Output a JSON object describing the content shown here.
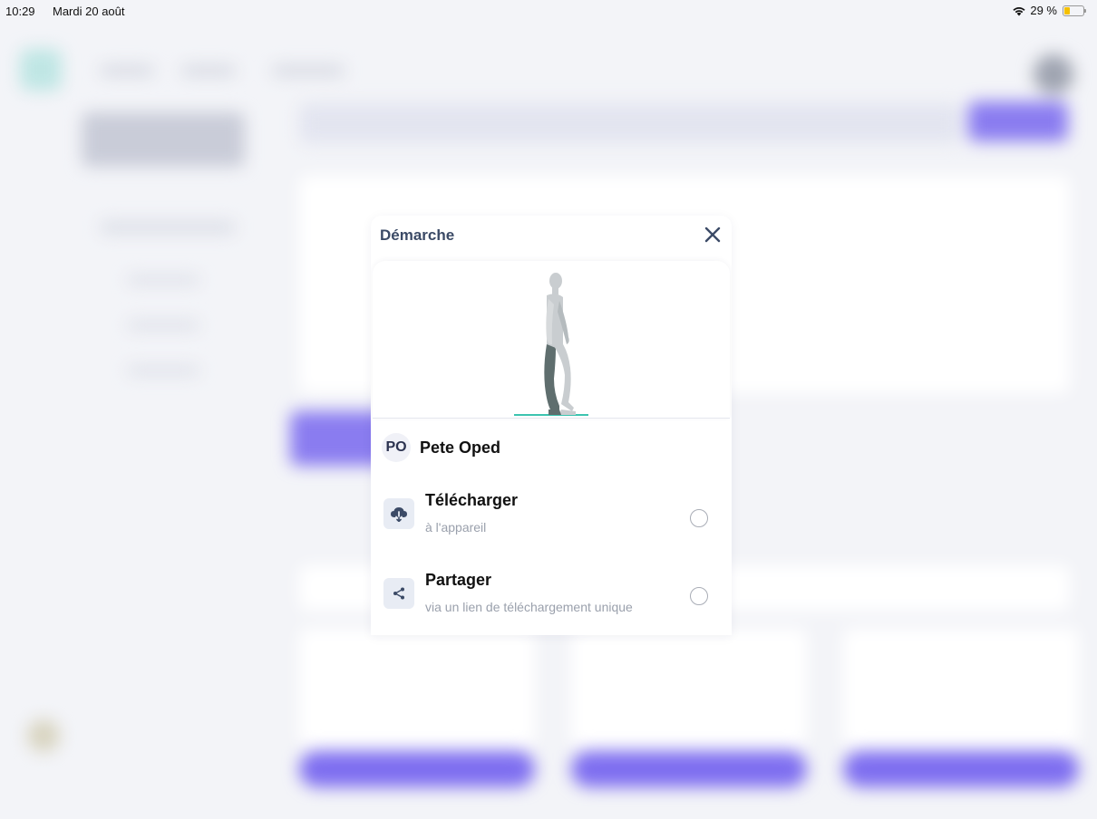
{
  "status_bar": {
    "time": "10:29",
    "date": "Mardi 20 août",
    "battery_text": "29 %",
    "battery_level": 0.29,
    "wifi_icon": "wifi-icon"
  },
  "modal": {
    "title": "Démarche",
    "close_icon": "close-icon",
    "figure": "walking-person-figure",
    "patient": {
      "initials": "PO",
      "name": "Pete Oped"
    },
    "options": [
      {
        "title": "Télécharger",
        "subtitle": "à l'appareil",
        "icon": "cloud-download-icon",
        "selected": false
      },
      {
        "title": "Partager",
        "subtitle": "via un lien de téléchargement unique",
        "icon": "share-icon",
        "selected": false
      }
    ]
  },
  "colors": {
    "accent": "#7b68ee",
    "teal_ground": "#3cc4b0",
    "title_text": "#3b4a66",
    "icon_bg": "#e8ecf4"
  }
}
